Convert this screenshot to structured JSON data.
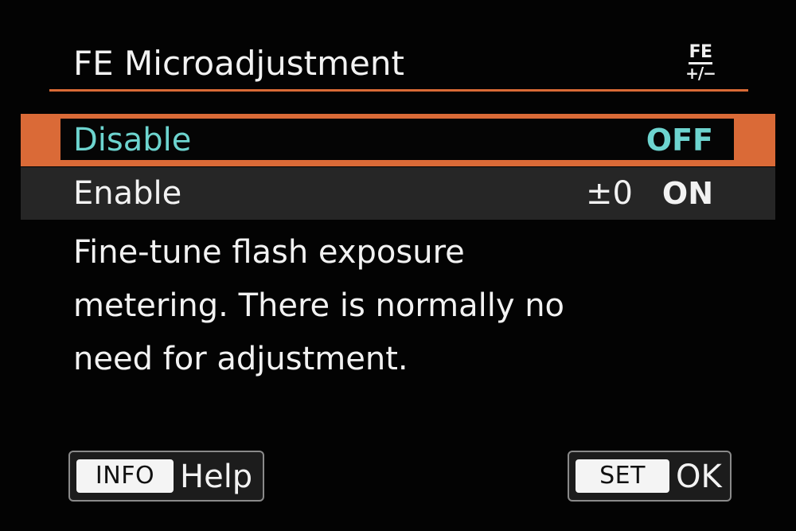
{
  "header": {
    "title": "FE Microadjustment",
    "icon": {
      "name": "fe-plus-minus-icon",
      "top": "FE",
      "bottom": "+/−"
    }
  },
  "menu": {
    "items": [
      {
        "label": "Disable",
        "value": "",
        "state": "OFF",
        "selected": true
      },
      {
        "label": "Enable",
        "value": "±0",
        "state": "ON",
        "selected": false
      }
    ]
  },
  "description": {
    "lines": [
      "Fine-tune flash exposure",
      "metering. There is normally no",
      "need for adjustment."
    ]
  },
  "footer": {
    "info_key": "INFO",
    "info_label": "Help",
    "set_key": "SET",
    "set_label": "OK"
  },
  "colors": {
    "accent": "#da6a37",
    "selected_text": "#6dd4cf",
    "background": "#030303"
  }
}
